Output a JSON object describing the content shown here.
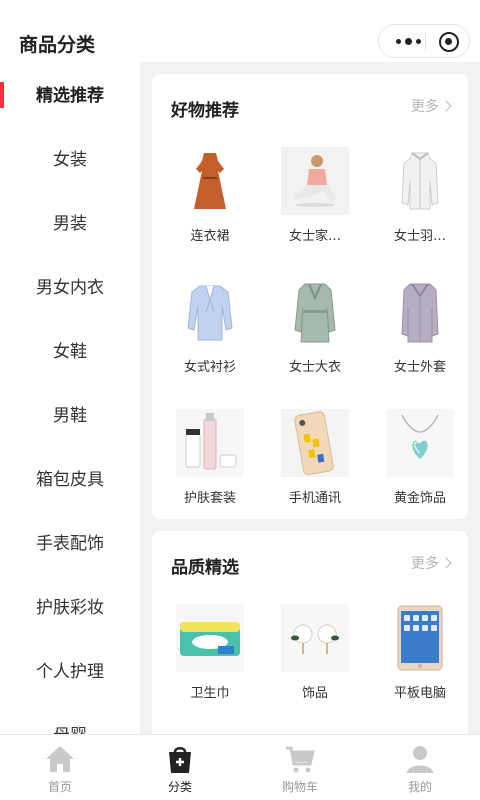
{
  "header": {
    "title": "商品分类"
  },
  "sidebar": {
    "items": [
      {
        "label": "精选推荐",
        "active": true
      },
      {
        "label": "女装"
      },
      {
        "label": "男装"
      },
      {
        "label": "男女内衣"
      },
      {
        "label": "女鞋"
      },
      {
        "label": "男鞋"
      },
      {
        "label": "箱包皮具"
      },
      {
        "label": "手表配饰"
      },
      {
        "label": "护肤彩妆"
      },
      {
        "label": "个人护理"
      },
      {
        "label": "母婴"
      }
    ]
  },
  "sections": [
    {
      "title": "好物推荐",
      "more_label": "更多",
      "items": [
        {
          "label": "连衣裙",
          "icon": "dress-image"
        },
        {
          "label": "女士家…",
          "icon": "loungewear-image"
        },
        {
          "label": "女士羽…",
          "icon": "down-jacket-image"
        },
        {
          "label": "女式衬衫",
          "icon": "shirt-image"
        },
        {
          "label": "女士大衣",
          "icon": "trench-coat-image"
        },
        {
          "label": "女士外套",
          "icon": "coat-image"
        },
        {
          "label": "护肤套装",
          "icon": "skincare-image"
        },
        {
          "label": "手机通讯",
          "icon": "phone-image"
        },
        {
          "label": "黄金饰品",
          "icon": "necklace-image"
        }
      ]
    },
    {
      "title": "品质精选",
      "more_label": "更多",
      "items": [
        {
          "label": "卫生巾",
          "icon": "sanitary-pad-image"
        },
        {
          "label": "饰品",
          "icon": "earrings-image"
        },
        {
          "label": "平板电脑",
          "icon": "tablet-image"
        }
      ]
    }
  ],
  "tabbar": {
    "tabs": [
      {
        "label": "首页",
        "icon": "home-icon"
      },
      {
        "label": "分类",
        "icon": "category-bag-icon",
        "active": true
      },
      {
        "label": "购物车",
        "icon": "cart-icon"
      },
      {
        "label": "我的",
        "icon": "user-icon"
      }
    ]
  },
  "colors": {
    "accent": "#ff2d3d",
    "background": "#f2f2f2",
    "muted": "#999999"
  }
}
